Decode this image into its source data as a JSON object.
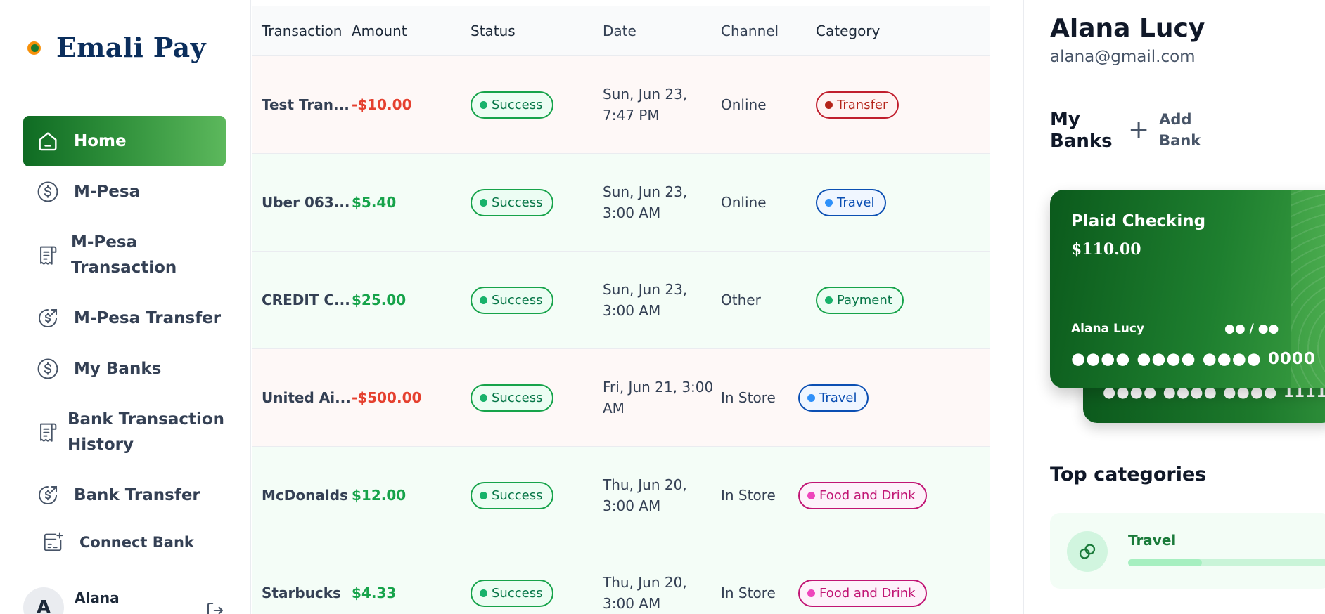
{
  "app": {
    "name": "Emali Pay"
  },
  "sidebar": {
    "items": [
      {
        "label": "Home",
        "icon": "home-icon"
      },
      {
        "label": "M-Pesa",
        "icon": "dollar-circle-icon"
      },
      {
        "label": "M-Pesa Transaction",
        "icon": "receipt-icon"
      },
      {
        "label": "M-Pesa Transfer",
        "icon": "money-send-icon"
      },
      {
        "label": "My Banks",
        "icon": "dollar-circle-icon"
      },
      {
        "label": "Bank Transaction History",
        "icon": "receipt-icon"
      },
      {
        "label": "Bank Transfer",
        "icon": "money-send-icon"
      },
      {
        "label": "Connect Bank",
        "icon": "connect-bank-icon"
      }
    ],
    "footer": {
      "avatar_initial": "A",
      "name": "Alana"
    }
  },
  "table": {
    "headers": [
      "Transaction",
      "Amount",
      "Status",
      "Date",
      "Channel",
      "Category"
    ],
    "rows": [
      {
        "name": "Test Tran...",
        "amount": "-$10.00",
        "type": "debit",
        "status": "Success",
        "date": "Sun, Jun 23, 7:47 PM",
        "channel": "Online",
        "category": "Transfer"
      },
      {
        "name": "Uber 063...",
        "amount": "$5.40",
        "type": "credit",
        "status": "Success",
        "date": "Sun, Jun 23, 3:00 AM",
        "channel": "Online",
        "category": "Travel"
      },
      {
        "name": "CREDIT C...",
        "amount": "$25.00",
        "type": "credit",
        "status": "Success",
        "date": "Sun, Jun 23, 3:00 AM",
        "channel": "Other",
        "category": "Payment"
      },
      {
        "name": "United Ai...",
        "amount": "-$500.00",
        "type": "debit",
        "status": "Success",
        "date": "Fri, Jun 21, 3:00 AM",
        "channel": "In Store",
        "category": "Travel"
      },
      {
        "name": "McDonalds",
        "amount": "$12.00",
        "type": "credit",
        "status": "Success",
        "date": "Thu, Jun 20, 3:00 AM",
        "channel": "In Store",
        "category": "Food and Drink"
      },
      {
        "name": "Starbucks",
        "amount": "$4.33",
        "type": "credit",
        "status": "Success",
        "date": "Thu, Jun 20, 3:00 AM",
        "channel": "In Store",
        "category": "Food and Drink"
      }
    ]
  },
  "profile": {
    "name": "Alana Lucy",
    "email": "alana@gmail.com"
  },
  "banks": {
    "title": "My Banks",
    "add_label": "Add Bank",
    "card": {
      "bank_name": "Plaid Checking",
      "balance": "$110.00",
      "holder": "Alana Lucy",
      "expiry": "●● / ●●",
      "number": "●●●● ●●●● ●●●● 0000"
    },
    "back_card_number": "●●●● ●●●● ●●●● 1111"
  },
  "top_categories": {
    "title": "Top categories",
    "items": [
      {
        "name": "Travel",
        "progress": 0.35
      }
    ]
  },
  "colors": {
    "brand_green": "#1e7f2f",
    "debit_red": "#e5402f",
    "credit_green": "#16a34a",
    "logo_navy": "#0b2e5c"
  }
}
